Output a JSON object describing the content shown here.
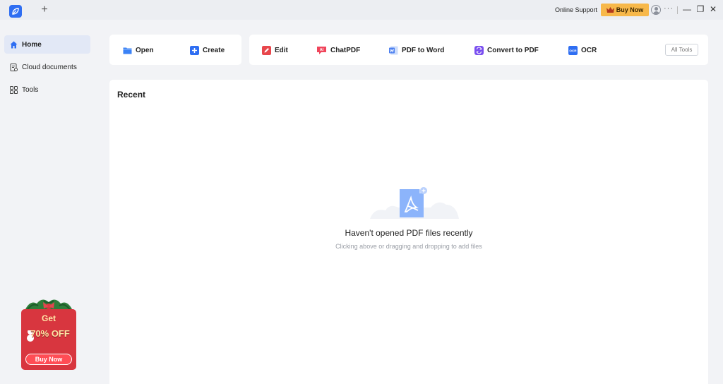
{
  "titlebar": {
    "new_tab_symbol": "+",
    "online_support": "Online Support",
    "buy_now": "Buy Now",
    "more": "···",
    "minimize": "—",
    "maximize": "❐",
    "close": "✕",
    "icons": [
      "app-logo-icon",
      "crown-icon",
      "user-icon",
      "more-icon",
      "minimize-icon",
      "maximize-icon",
      "close-icon"
    ]
  },
  "sidebar": {
    "items": [
      {
        "label": "Home",
        "icon": "home-icon",
        "active": true
      },
      {
        "label": "Cloud documents",
        "icon": "cloud-document-icon",
        "active": false
      },
      {
        "label": "Tools",
        "icon": "grid-icon",
        "active": false
      }
    ],
    "promo": {
      "get": "Get",
      "discount": "70% OFF",
      "button": "Buy Now"
    }
  },
  "actions": {
    "open": "Open",
    "create": "Create",
    "edit": "Edit",
    "chatpdf": "ChatPDF",
    "chatpdf_badge": "AI",
    "pdf_to_word": "PDF to Word",
    "convert_to_pdf": "Convert to PDF",
    "ocr": "OCR",
    "ocr_badge": "OCR",
    "all_tools": "All Tools"
  },
  "recent": {
    "title": "Recent",
    "empty_title": "Haven't opened PDF files recently",
    "empty_subtitle": "Clicking above or dragging and dropping to add files"
  },
  "colors": {
    "accent": "#2f6ef2",
    "buy_now_bg": "#f7b84a",
    "edit_red": "#e8474c",
    "chat_red": "#f0455b",
    "word_blue": "#4a7ef0",
    "convert_purple": "#7a4ff0",
    "promo_red": "#d8363f"
  }
}
